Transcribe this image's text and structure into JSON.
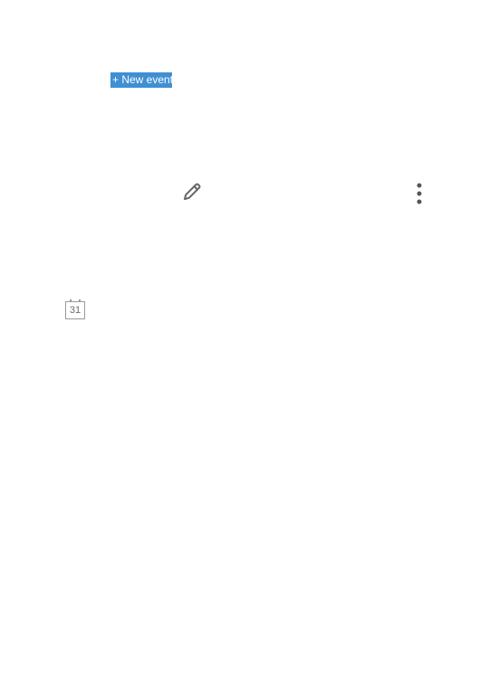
{
  "toolbar": {
    "new_event_label": "+ New event"
  },
  "icons": {
    "edit": "pencil-icon",
    "more": "more-vert-icon",
    "calendar": "calendar-icon"
  },
  "calendar_icon": {
    "day_number": "31"
  },
  "colors": {
    "accent": "#3f8fd3",
    "icon_gray": "#666666",
    "calendar_stroke": "#9a9a9a"
  }
}
